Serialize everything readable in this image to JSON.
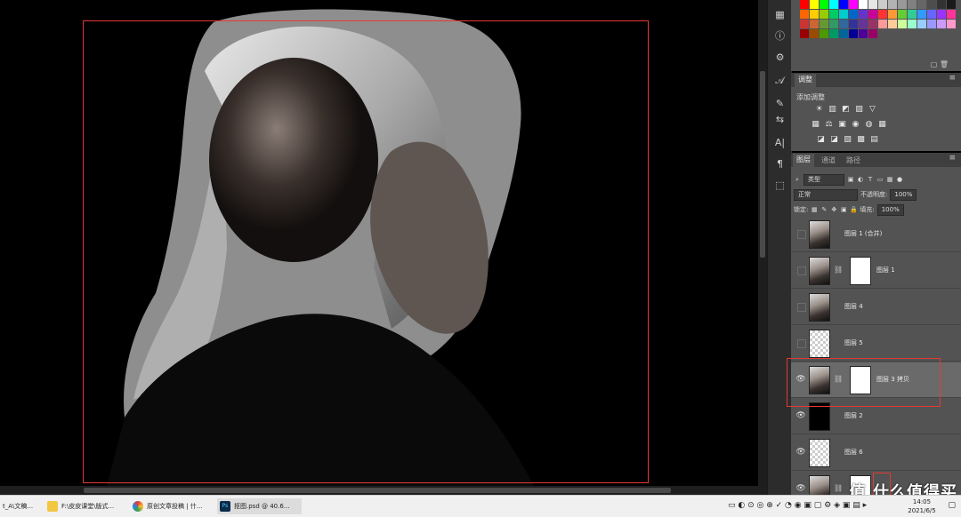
{
  "swatch_colors": [
    "#ff0000",
    "#ffff00",
    "#00ff00",
    "#00ffff",
    "#0000ff",
    "#ff00ff",
    "#ffffff",
    "#e6e6e6",
    "#cccccc",
    "#b3b3b3",
    "#999999",
    "#808080",
    "#666666",
    "#4d4d4d",
    "#333333",
    "#1a1a1a",
    "#ff6600",
    "#ffcc00",
    "#99cc00",
    "#00cc66",
    "#00cccc",
    "#0066cc",
    "#6633cc",
    "#cc0099",
    "#ff3333",
    "#ff9933",
    "#66cc33",
    "#33cc99",
    "#3399ff",
    "#6666ff",
    "#9933ff",
    "#ff3399",
    "#cc3333",
    "#cc6633",
    "#669933",
    "#339966",
    "#336699",
    "#333399",
    "#663399",
    "#993366",
    "#ff9999",
    "#ffcc99",
    "#ccff99",
    "#99ffcc",
    "#99ccff",
    "#9999ff",
    "#cc99ff",
    "#ff99cc",
    "#990000",
    "#994c00",
    "#4c9900",
    "#009966",
    "#006699",
    "#000099",
    "#4c0099",
    "#990066"
  ],
  "swatches": {
    "footer_icons": "▢ 🗑"
  },
  "adjust_panel": {
    "tab": "调整",
    "add_label": "添加调整",
    "row1": [
      "☀",
      "▥",
      "◩",
      "▨",
      "▽"
    ],
    "row2": [
      "▦",
      "⚖",
      "▣",
      "◉",
      "◍",
      "▦"
    ],
    "row3": [
      "◪",
      "◪",
      "▧",
      "▩",
      "▤"
    ]
  },
  "layers_panel": {
    "tabs": [
      "图层",
      "通道",
      "路径"
    ],
    "filter_label": "类型",
    "blend_mode": "正常",
    "opacity_label": "不透明度:",
    "opacity": "100%",
    "lock_label": "锁定:",
    "fill_label": "填充:",
    "fill": "100%",
    "layers": [
      {
        "name": "图层 1 (合并)",
        "visible": false,
        "thumb": "portrait",
        "mask": false
      },
      {
        "name": "图层 1",
        "visible": false,
        "thumb": "portrait",
        "mask": true
      },
      {
        "name": "图层 4",
        "visible": false,
        "thumb": "portrait-partial",
        "mask": false
      },
      {
        "name": "图层 5",
        "visible": false,
        "thumb": "stroke",
        "mask": false
      },
      {
        "name": "图层 3 拷贝",
        "visible": true,
        "thumb": "portrait",
        "mask": true,
        "selected": true
      },
      {
        "name": "图层 2",
        "visible": true,
        "thumb": "black",
        "mask": false
      },
      {
        "name": "图层 6",
        "visible": true,
        "thumb": "checker",
        "mask": false
      },
      {
        "name": "",
        "visible": true,
        "thumb": "portrait",
        "mask": true
      }
    ]
  },
  "taskbar": {
    "items": [
      "t_A\\文稿...",
      "F:\\皮皮课堂\\版式...",
      "原创文章投稿 | 什...",
      "抠图.psd @ 40.6..."
    ],
    "time": "14:05",
    "date": "2021/6/5"
  },
  "watermark": "值 什么值得买",
  "tools": [
    "▦",
    "ⓘ",
    "⚙",
    "𝒜",
    "✎",
    "⇆",
    "A|",
    "¶",
    "⬚"
  ]
}
